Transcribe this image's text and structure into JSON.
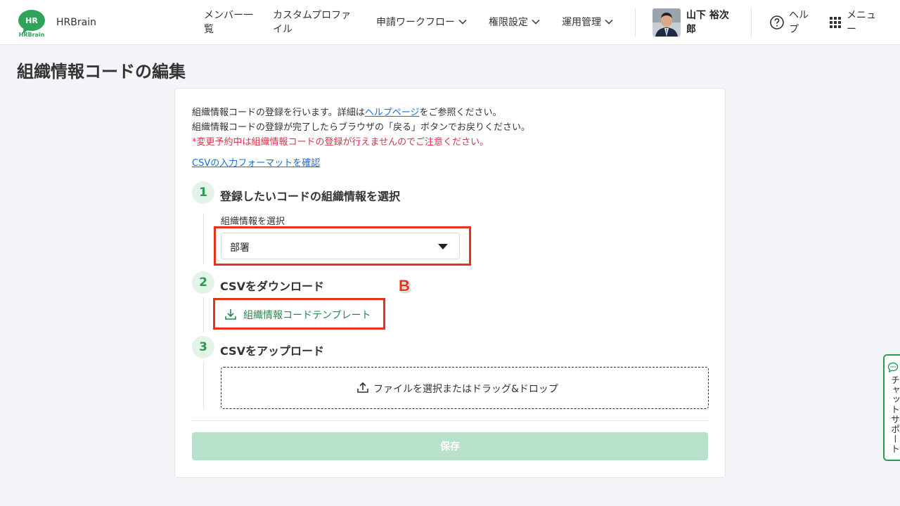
{
  "header": {
    "brand": "HRBrain",
    "logo_text_top": "HR",
    "logo_text_bottom": "HRBrain",
    "nav": {
      "members": "メンバー一覧",
      "custom_profile": "カスタムプロファイル",
      "workflow": "申請ワークフロー",
      "permissions": "権限設定",
      "operations": "運用管理"
    },
    "user_name": "山下 裕次郎",
    "help_label": "ヘルプ",
    "menu_label": "メニュー"
  },
  "page": {
    "title": "組織情報コードの編集"
  },
  "intro": {
    "line1_prefix": "組織情報コードの登録を行います。詳細は",
    "help_link": "ヘルプページ",
    "line1_suffix": "をご参照ください。",
    "line2": "組織情報コードの登録が完了したらブラウザの「戻る」ボタンでお戻りください。",
    "warning": "*変更予約中は組織情報コードの登録が行えませんのでご注意ください。",
    "format_link": "CSVの入力フォーマットを確認"
  },
  "steps": [
    {
      "number": "1",
      "title": "登録したいコードの組織情報を選択"
    },
    {
      "number": "2",
      "title": "CSVをダウンロード"
    },
    {
      "number": "3",
      "title": "CSVをアップロード"
    }
  ],
  "select": {
    "label": "組織情報を選択",
    "value": "部署"
  },
  "download": {
    "label": "組織情報コードテンプレート"
  },
  "upload": {
    "label": "ファイルを選択またはドラッグ&ドロップ"
  },
  "annotation": {
    "letter": "B"
  },
  "save_label": "保存",
  "chat_support": "チャットサポート",
  "colors": {
    "accent_green": "#2a9a55",
    "annotation_red": "#e8331c",
    "warning_red": "#d6334a",
    "link_blue": "#1a6ed8"
  }
}
